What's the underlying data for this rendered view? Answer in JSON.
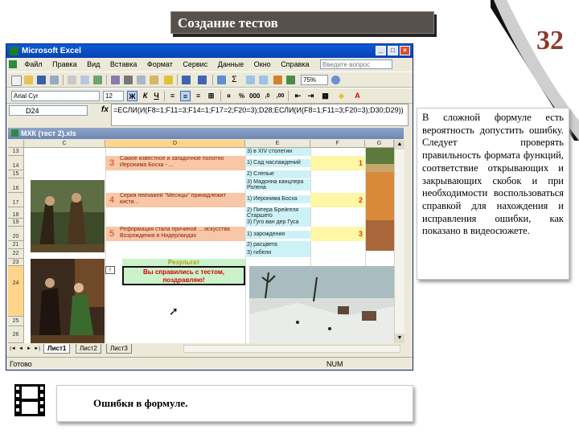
{
  "slide": {
    "title": "Создание тестов",
    "page_number": "32",
    "note_text": "В сложной формуле есть вероятность допустить ошибку. Следует проверять правильность формата функций, соответствие открывающих и закрывающих скобок и при необходимости воспользоваться справкой для нахождения и исправления ошибки, как показано в видеосюжете.",
    "caption": "Ошибки в формуле."
  },
  "excel": {
    "app_title": "Microsoft Excel",
    "menu": [
      "Файл",
      "Правка",
      "Вид",
      "Вставка",
      "Формат",
      "Сервис",
      "Данные",
      "Окно",
      "Справка"
    ],
    "help_placeholder": "Введите вопрос",
    "zoom": "75%",
    "font_name": "Arial Cyr",
    "font_size": "12",
    "name_box": "D24",
    "fx_label": "fx",
    "formula": "=ЕСЛИ(И(F8=1;F11=3;F14=1;F17=2;F20=3);D28;ЕСЛИ(И(F8=1;F11=3;F20=3);D30;D29))",
    "workbook_title": "МХК (тест 2).xls",
    "columns": [
      "C",
      "D",
      "E",
      "F",
      "G"
    ],
    "rows": [
      "13",
      "14",
      "15",
      "16",
      "17",
      "18",
      "19",
      "20",
      "21",
      "22",
      "23",
      "24",
      "25",
      "26"
    ],
    "questions": [
      {
        "num": "3",
        "text": "Самое известное и загадочное полотно Иеронима Босха - ...",
        "score": "1"
      },
      {
        "num": "4",
        "text": "Серия пейзажей \"Месяцы\" принадлежит кисти...",
        "score": "2"
      },
      {
        "num": "5",
        "text": "Реформация стала причиной ... искусства Возрождения в Нидерландах",
        "score": "3"
      }
    ],
    "answers": [
      "3) в XIV столетии",
      "1) Сад наслаждений",
      "2) Слепые",
      "3) Мадонна канцлера Ролена",
      "1) Иеронима Босха",
      "2) Питера Брейгеля Старшего",
      "3) Гуго ван дер Гуса",
      "1) зарождения",
      "2) расцвета",
      "3) гибели"
    ],
    "result_label": "Результат",
    "result_message": "Вы справились с тестом, поздравляю!",
    "sheets": [
      "Лист1",
      "Лист2",
      "Лист3"
    ],
    "status_left": "Готово",
    "status_num": "NUM"
  }
}
